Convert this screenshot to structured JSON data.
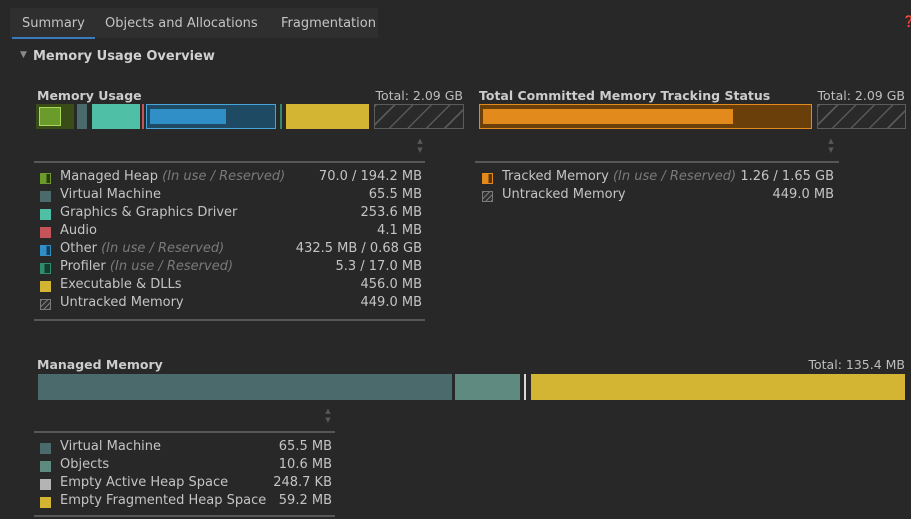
{
  "tabs": [
    {
      "label": "Summary",
      "selected": true
    },
    {
      "label": "Objects and Allocations",
      "selected": false
    },
    {
      "label": "Fragmentation",
      "selected": false
    }
  ],
  "help_icon": "help-icon",
  "overview": {
    "title": "Memory Usage Overview",
    "expanded": true
  },
  "memory_usage": {
    "title": "Memory Usage",
    "total": "Total: 2.09 GB",
    "legend": [
      {
        "label": "Managed Heap",
        "sub": "(In use / Reserved)",
        "value": "70.0 / 194.2 MB",
        "color": "#6b9b2a",
        "style": "split"
      },
      {
        "label": "Virtual Machine",
        "sub": "",
        "value": "65.5 MB",
        "color": "#4a6a6c",
        "style": "solid"
      },
      {
        "label": "Graphics & Graphics Driver",
        "sub": "",
        "value": "253.6 MB",
        "color": "#4fbfa5",
        "style": "solid"
      },
      {
        "label": "Audio",
        "sub": "",
        "value": "4.1 MB",
        "color": "#c4545a",
        "style": "solid"
      },
      {
        "label": "Other",
        "sub": "(In use / Reserved)",
        "value": "432.5 MB / 0.68 GB",
        "color": "#2f8fc6",
        "style": "split"
      },
      {
        "label": "Profiler",
        "sub": "(In use / Reserved)",
        "value": "5.3 / 17.0 MB",
        "color": "#2e8d6e",
        "style": "split"
      },
      {
        "label": "Executable & DLLs",
        "sub": "",
        "value": "456.0 MB",
        "color": "#d4b433",
        "style": "solid"
      },
      {
        "label": "Untracked Memory",
        "sub": "",
        "value": "449.0 MB",
        "color": "#7a7a7a",
        "style": "hatch"
      }
    ]
  },
  "tracking_status": {
    "title": "Total Committed Memory Tracking Status",
    "total": "Total: 2.09 GB",
    "legend": [
      {
        "label": "Tracked Memory",
        "sub": "(In use / Reserved)",
        "value": "1.26 / 1.65 GB",
        "color": "#e28a1b",
        "style": "split"
      },
      {
        "label": "Untracked Memory",
        "sub": "",
        "value": "449.0 MB",
        "color": "#7a7a7a",
        "style": "hatch"
      }
    ]
  },
  "managed_memory": {
    "title": "Managed Memory",
    "total": "Total: 135.4 MB",
    "legend": [
      {
        "label": "Virtual Machine",
        "value": "65.5 MB",
        "color": "#4a6a6c",
        "style": "solid"
      },
      {
        "label": "Objects",
        "value": "10.6 MB",
        "color": "#5f8a80",
        "style": "solid"
      },
      {
        "label": "Empty Active Heap Space",
        "value": "248.7 KB",
        "color": "#b4b4b4",
        "style": "solid"
      },
      {
        "label": "Empty Fragmented Heap Space",
        "value": "59.2 MB",
        "color": "#d4b433",
        "style": "solid"
      }
    ]
  }
}
